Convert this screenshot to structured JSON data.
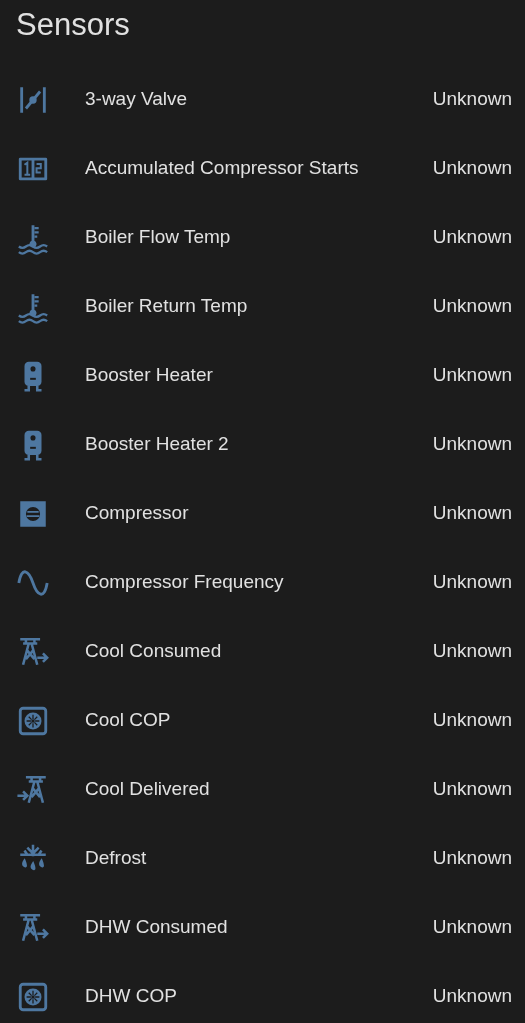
{
  "title": "Sensors",
  "rows": [
    {
      "name": "3-way Valve",
      "state": "Unknown"
    },
    {
      "name": "Accumulated Compressor Starts",
      "state": "Unknown"
    },
    {
      "name": "Boiler Flow Temp",
      "state": "Unknown"
    },
    {
      "name": "Boiler Return Temp",
      "state": "Unknown"
    },
    {
      "name": "Booster Heater",
      "state": "Unknown"
    },
    {
      "name": "Booster Heater 2",
      "state": "Unknown"
    },
    {
      "name": "Compressor",
      "state": "Unknown"
    },
    {
      "name": "Compressor Frequency",
      "state": "Unknown"
    },
    {
      "name": "Cool Consumed",
      "state": "Unknown"
    },
    {
      "name": "Cool COP",
      "state": "Unknown"
    },
    {
      "name": "Cool Delivered",
      "state": "Unknown"
    },
    {
      "name": "Defrost",
      "state": "Unknown"
    },
    {
      "name": "DHW Consumed",
      "state": "Unknown"
    },
    {
      "name": "DHW COP",
      "state": "Unknown"
    }
  ]
}
